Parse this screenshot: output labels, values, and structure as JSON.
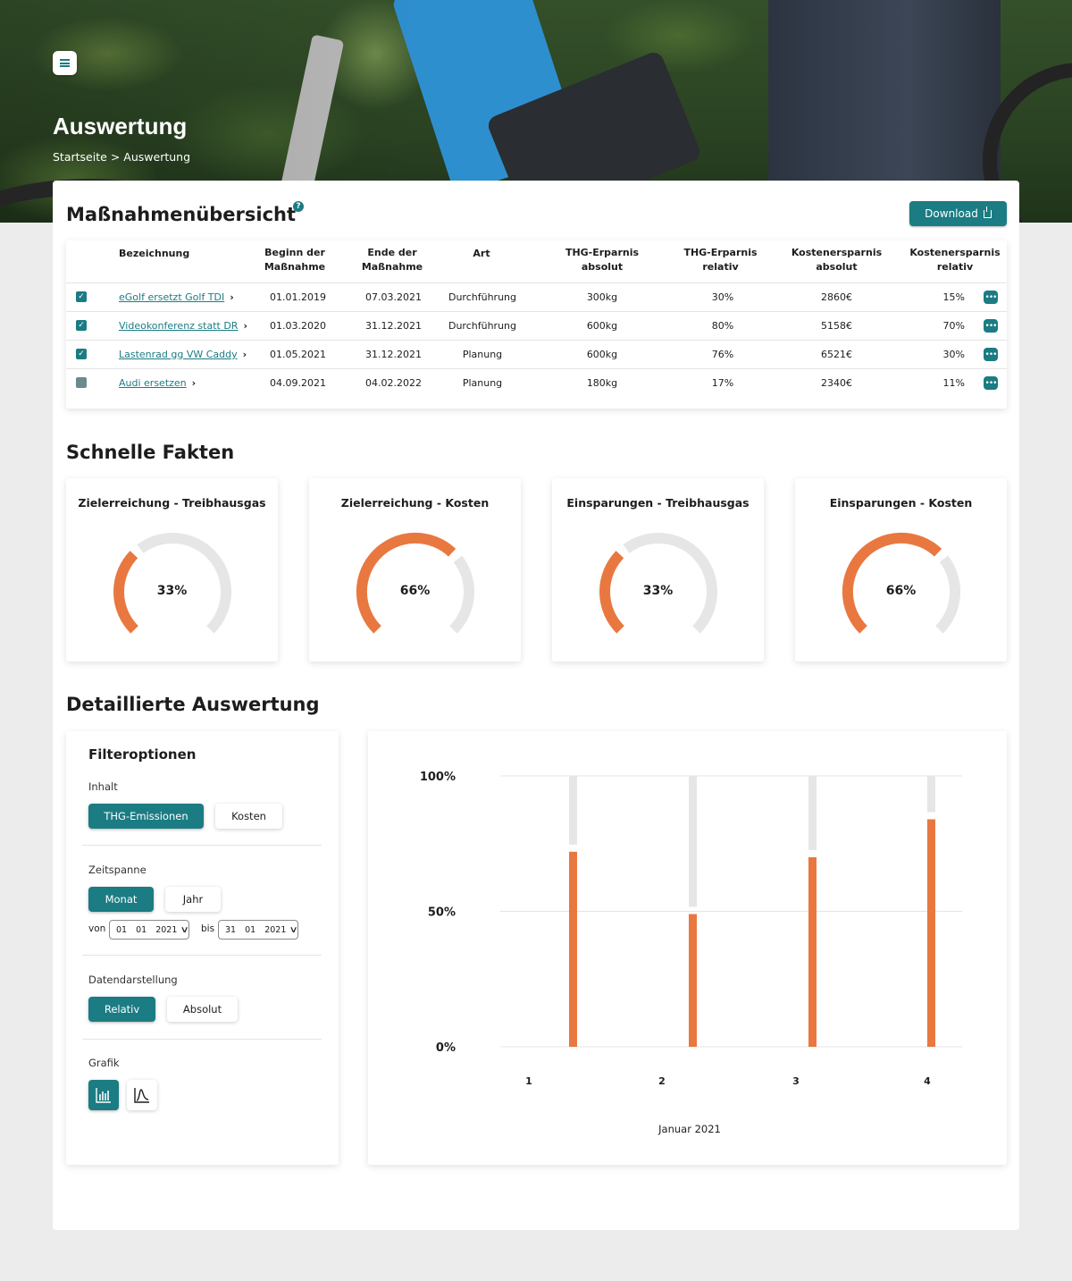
{
  "header": {
    "title": "Auswertung",
    "breadcrumb": [
      "Startseite",
      ">",
      "Auswertung"
    ]
  },
  "overview": {
    "title": "Maßnahmenübersicht",
    "help": "?",
    "download_label": "Download",
    "columns": [
      "Bezeichnung",
      "Beginn der Maßnahme",
      "Ende der Maßnahme",
      "Art",
      "THG-Erparnis absolut",
      "THG-Erparnis relativ",
      "Kostenersparnis absolut",
      "Kostenersparnis relativ"
    ],
    "rows": [
      {
        "checked": true,
        "name": "eGolf ersetzt Golf TDI",
        "start": "01.01.2019",
        "end": "07.03.2021",
        "type": "Durchführung",
        "thg_abs": "300kg",
        "thg_rel": "30%",
        "cost_abs": "2860€",
        "cost_rel": "15%"
      },
      {
        "checked": true,
        "name": "Videokonferenz statt DR",
        "start": "01.03.2020",
        "end": "31.12.2021",
        "type": "Durchführung",
        "thg_abs": "600kg",
        "thg_rel": "80%",
        "cost_abs": "5158€",
        "cost_rel": "70%"
      },
      {
        "checked": true,
        "name": "Lastenrad gg VW Caddy",
        "start": "01.05.2021",
        "end": "31.12.2021",
        "type": "Planung",
        "thg_abs": "600kg",
        "thg_rel": "76%",
        "cost_abs": "6521€",
        "cost_rel": "30%"
      },
      {
        "checked": false,
        "name": "Audi ersetzen",
        "start": "04.09.2021",
        "end": "04.02.2022",
        "type": "Planung",
        "thg_abs": "180kg",
        "thg_rel": "17%",
        "cost_abs": "2340€",
        "cost_rel": "11%"
      }
    ]
  },
  "facts": {
    "title": "Schnelle Fakten",
    "items": [
      {
        "title": "Zielerreichung - Treibhausgas",
        "value": "33%",
        "fraction": 0.33
      },
      {
        "title": "Zielerreichung - Kosten",
        "value": "66%",
        "fraction": 0.66
      },
      {
        "title": "Einsparungen - Treibhausgas",
        "value": "33%",
        "fraction": 0.33
      },
      {
        "title": "Einsparungen - Kosten",
        "value": "66%",
        "fraction": 0.66
      }
    ]
  },
  "detail": {
    "title": "Detaillierte Auswertung",
    "filter": {
      "title": "Filteroptionen",
      "content_label": "Inhalt",
      "content_options": [
        "THG-Emissionen",
        "Kosten"
      ],
      "content_selected": "THG-Emissionen",
      "period_label": "Zeitspanne",
      "period_options": [
        "Monat",
        "Jahr"
      ],
      "period_selected": "Monat",
      "from_label": "von",
      "from_date": {
        "day": "01",
        "month": "01",
        "year": "2021"
      },
      "to_label": "bis",
      "to_date": {
        "day": "31",
        "month": "01",
        "year": "2021"
      },
      "display_label": "Datendarstellung",
      "display_options": [
        "Relativ",
        "Absolut"
      ],
      "display_selected": "Relativ",
      "graphic_label": "Grafik",
      "graphic_options": [
        "bar-chart-icon",
        "line-chart-icon"
      ],
      "graphic_selected": "bar-chart-icon"
    }
  },
  "colors": {
    "accent": "#1b7c83",
    "orange": "#e87840",
    "track": "#e6e6e6"
  },
  "chart_data": {
    "type": "bar",
    "categories": [
      "1",
      "2",
      "3",
      "4"
    ],
    "values": [
      72,
      49,
      70,
      84
    ],
    "yticks": [
      "0%",
      "50%",
      "100%"
    ],
    "ylim": [
      0,
      100
    ],
    "xlabel": "Januar 2021",
    "ylabel": "",
    "grid": true
  }
}
